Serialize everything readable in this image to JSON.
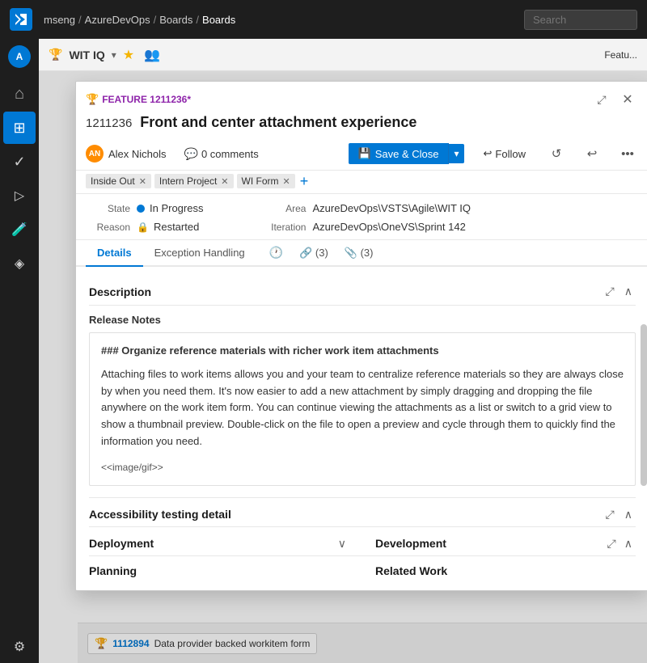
{
  "topNav": {
    "logo": "VS",
    "breadcrumbs": [
      "mseng",
      "AzureDevOps",
      "Boards",
      "Boards"
    ],
    "search_placeholder": "Search"
  },
  "sidebar": {
    "avatar_initials": "A",
    "items": [
      {
        "icon": "⊞",
        "name": "home"
      },
      {
        "icon": "⋯",
        "name": "more"
      },
      {
        "icon": "◈",
        "name": "boards"
      },
      {
        "icon": "✓",
        "name": "tasks"
      },
      {
        "icon": "⬡",
        "name": "pipelines"
      },
      {
        "icon": "▶",
        "name": "test"
      },
      {
        "icon": "⚙",
        "name": "settings"
      }
    ]
  },
  "witBar": {
    "icon": "⊞",
    "title": "WIT IQ",
    "dropdown_icon": "▾",
    "star_icon": "★",
    "people_icon": "👥",
    "right_label": "Featu..."
  },
  "modal": {
    "feature_label": "FEATURE 1211236*",
    "work_item_id": "1211236",
    "title": "Front and center attachment experience",
    "assignee": {
      "initials": "AN",
      "name": "Alex Nichols"
    },
    "comments_count": "0 comments",
    "save_close_label": "Save & Close",
    "save_icon": "💾",
    "follow_label": "Follow",
    "refresh_icon": "↺",
    "undo_icon": "↩",
    "more_icon": "...",
    "tags": [
      "Inside Out",
      "Intern Project",
      "WI Form"
    ],
    "state": {
      "label": "State",
      "value": "In Progress",
      "dot_color": "#0078d4"
    },
    "reason": {
      "label": "Reason",
      "value": "Restarted"
    },
    "area": {
      "label": "Area",
      "value": "AzureDevOps\\VSTS\\Agile\\WIT IQ"
    },
    "iteration": {
      "label": "Iteration",
      "value": "AzureDevOps\\OneVS\\Sprint 142"
    },
    "tabs": [
      {
        "label": "Details",
        "active": true
      },
      {
        "label": "Exception Handling",
        "active": false
      }
    ],
    "tab_history": "🕐",
    "tab_links": "🔗 (3)",
    "tab_attachments": "📎 (3)",
    "description_title": "Description",
    "release_notes_title": "Release Notes",
    "release_notes_heading": "### Organize reference materials with richer work item attachments",
    "release_notes_body": "Attaching files to work items allows you and your team to centralize reference materials so they are always close by when you need them. It's now easier to add a new attachment by simply dragging and dropping the file anywhere on the work item form. You can continue viewing the attachments as a list or switch to a grid view to show a thumbnail preview. Double-click on the file to open a preview and cycle through them to quickly find the information you need.",
    "release_notes_gif": "<<image/gif>>",
    "accessibility_title": "Accessibility testing detail",
    "deployment_title": "Deployment",
    "development_title": "Development",
    "planning_title": "Planning",
    "related_work_title": "Related Work"
  },
  "bottomBar": {
    "item_icon": "⊞",
    "item_id": "1112894",
    "item_label": "Data provider backed workitem form"
  }
}
